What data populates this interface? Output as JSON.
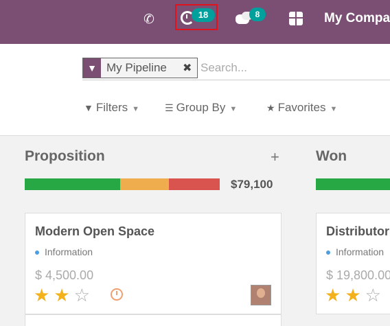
{
  "navbar": {
    "phone_icon": "phone-icon",
    "activity_count": "18",
    "messages_count": "8",
    "company_name": "My Compa"
  },
  "search": {
    "facet_label": "My Pipeline",
    "facet_remove": "✖",
    "placeholder": "Search..."
  },
  "controls": {
    "filters_label": "Filters",
    "groupby_label": "Group By",
    "favorites_label": "Favorites"
  },
  "columns": [
    {
      "title": "Proposition",
      "add_label": "+",
      "total": "$79,100",
      "progress": [
        {
          "status": "planned",
          "fraction": 0.49,
          "color": "#28a745"
        },
        {
          "status": "today",
          "fraction": 0.25,
          "color": "#f0ad4e"
        },
        {
          "status": "overdue",
          "fraction": 0.26,
          "color": "#d9534f"
        }
      ],
      "cards": [
        {
          "title": "Modern Open Space",
          "tag": "Information",
          "amount": "$ 4,500.00",
          "stars_filled": 2,
          "stars_total": 3
        }
      ]
    },
    {
      "title": "Won",
      "progress": [
        {
          "status": "planned",
          "fraction": 1.0,
          "color": "#28a745"
        }
      ],
      "cards": [
        {
          "title": "Distributor",
          "tag": "Information",
          "amount": "$ 19,800.00",
          "stars_filled": 2,
          "stars_total": 3
        }
      ]
    }
  ],
  "colors": {
    "navbar": "#7b4f73",
    "badge": "#00a09d",
    "highlight": "#e0121c",
    "star": "#f3b11b"
  }
}
